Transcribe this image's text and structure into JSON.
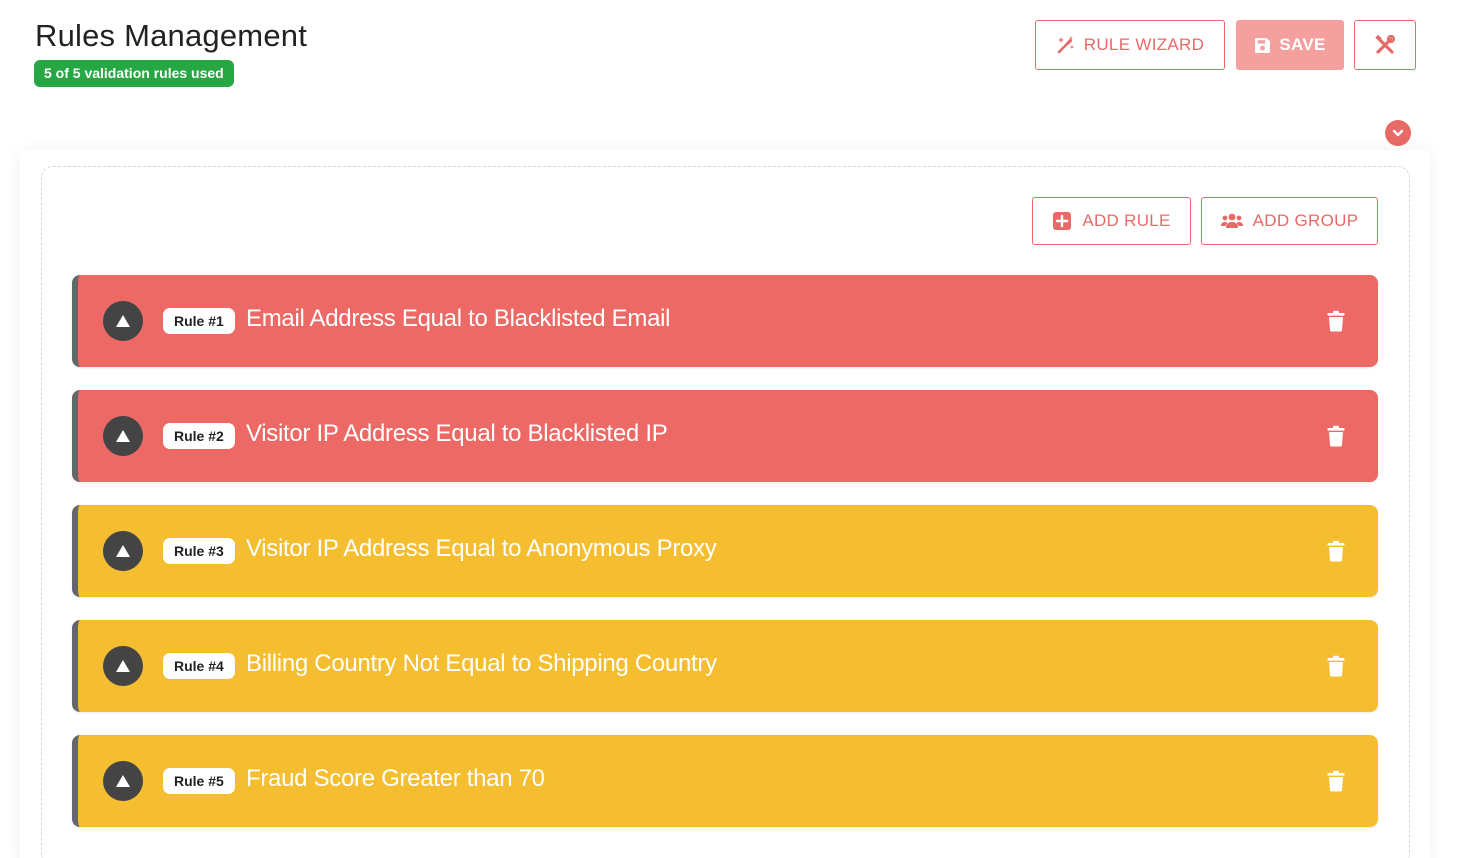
{
  "header": {
    "title": "Rules Management",
    "usage_badge": "5 of 5 validation rules used",
    "wizard_label": "RULE WIZARD",
    "save_label": "SAVE"
  },
  "toolbar": {
    "add_rule_label": "ADD RULE",
    "add_group_label": "ADD GROUP"
  },
  "colors": {
    "accent": "#e86a67",
    "badge_green": "#27a744",
    "rule_red": "#ec6965",
    "rule_yellow": "#f4be30"
  },
  "icons": [
    "magic-wand-icon",
    "floppy-disk-icon",
    "tools-icon",
    "chevron-down-icon",
    "plus-square-icon",
    "users-icon",
    "triangle-up-icon",
    "trash-icon"
  ],
  "rules": [
    {
      "tag": "Rule #1",
      "title": "Email Address Equal to Blacklisted Email",
      "color": "#ec6965"
    },
    {
      "tag": "Rule #2",
      "title": "Visitor IP Address Equal to Blacklisted IP",
      "color": "#ec6965"
    },
    {
      "tag": "Rule #3",
      "title": "Visitor IP Address Equal to Anonymous Proxy",
      "color": "#f4be30"
    },
    {
      "tag": "Rule #4",
      "title": "Billing Country Not Equal to Shipping Country",
      "color": "#f4be30"
    },
    {
      "tag": "Rule #5",
      "title": "Fraud Score Greater than 70",
      "color": "#f4be30"
    }
  ]
}
